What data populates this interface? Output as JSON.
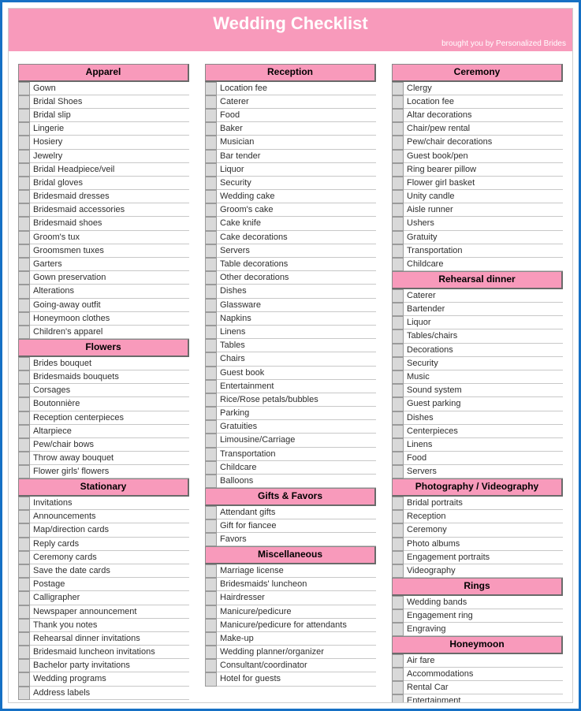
{
  "title": "Wedding Checklist",
  "subtitle": "brought you by Personalized Brides",
  "columns": [
    [
      {
        "header": "Apparel",
        "items": [
          "Gown",
          "Bridal Shoes",
          "Bridal slip",
          "Lingerie",
          "Hosiery",
          "Jewelry",
          "Bridal Headpiece/veil",
          "Bridal gloves",
          "Bridesmaid dresses",
          "Bridesmaid accessories",
          "Bridesmaid shoes",
          "Groom's tux",
          "Groomsmen tuxes",
          "Garters",
          "Gown preservation",
          "Alterations",
          "Going-away outfit",
          "Honeymoon clothes",
          "Children's apparel"
        ]
      },
      {
        "header": "Flowers",
        "items": [
          "Brides bouquet",
          "Bridesmaids bouquets",
          "Corsages",
          "Boutonnière",
          "Reception centerpieces",
          "Altarpiece",
          "Pew/chair bows",
          "Throw away bouquet",
          "Flower girls' flowers"
        ]
      },
      {
        "header": "Stationary",
        "items": [
          "Invitations",
          "Announcements",
          "Map/direction cards",
          "Reply cards",
          "Ceremony cards",
          "Save the date cards",
          "Postage",
          "Calligrapher",
          "Newspaper announcement",
          "Thank you notes",
          "Rehearsal dinner invitations",
          "Bridesmaid luncheon invitations",
          "Bachelor party invitations",
          "Wedding programs",
          "Address labels"
        ]
      }
    ],
    [
      {
        "header": "Reception",
        "items": [
          "Location fee",
          "Caterer",
          "Food",
          "Baker",
          "Musician",
          "Bar tender",
          "Liquor",
          "Security",
          "Wedding cake",
          "Groom's cake",
          "Cake knife",
          "Cake decorations",
          "Servers",
          "Table decorations",
          "Other decorations",
          "Dishes",
          "Glassware",
          "Napkins",
          "Linens",
          "Tables",
          "Chairs",
          "Guest book",
          "Entertainment",
          "Rice/Rose petals/bubbles",
          "Parking",
          "Gratuities",
          "Limousine/Carriage",
          "Transportation",
          "Childcare",
          "Balloons"
        ]
      },
      {
        "header": "Gifts & Favors",
        "items": [
          "Attendant gifts",
          "Gift for fiancee",
          "Favors"
        ]
      },
      {
        "header": "Miscellaneous",
        "items": [
          "Marriage license",
          "Bridesmaids' luncheon",
          "Hairdresser",
          "Manicure/pedicure",
          "Manicure/pedicure for attendants",
          "Make-up",
          "Wedding planner/organizer",
          "Consultant/coordinator",
          "Hotel for guests"
        ]
      }
    ],
    [
      {
        "header": "Ceremony",
        "items": [
          "Clergy",
          "Location fee",
          "Altar decorations",
          "Chair/pew rental",
          "Pew/chair decorations",
          "Guest book/pen",
          "Ring bearer pillow",
          "Flower girl basket",
          "Unity candle",
          "Aisle runner",
          "Ushers",
          "Gratuity",
          "Transportation",
          "Childcare"
        ]
      },
      {
        "header": "Rehearsal dinner",
        "items": [
          "Caterer",
          "Bartender",
          "Liquor",
          "Tables/chairs",
          "Decorations",
          "Security",
          "Music",
          "Sound system",
          "Guest parking",
          "Dishes",
          "Centerpieces",
          "Linens",
          "Food",
          "Servers"
        ]
      },
      {
        "header": "Photography / Videography",
        "items": [
          "Bridal portraits",
          "Reception",
          "Ceremony",
          "Photo albums",
          "Engagement portraits",
          "Videography"
        ]
      },
      {
        "header": "Rings",
        "items": [
          "Wedding bands",
          "Engagement ring",
          "Engraving"
        ]
      },
      {
        "header": "Honeymoon",
        "items": [
          "Air fare",
          "Accommodations",
          "Rental Car",
          "Entertainment"
        ]
      }
    ]
  ]
}
